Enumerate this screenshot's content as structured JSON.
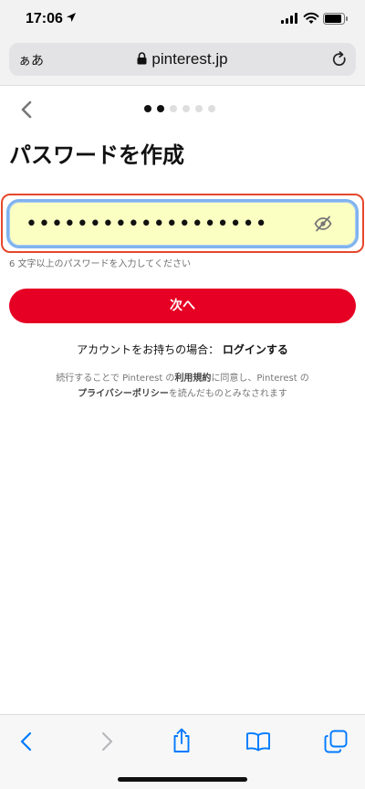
{
  "status_bar": {
    "time": "17:06"
  },
  "address_bar": {
    "aa_label": "ぁあ",
    "url": "pinterest.jp"
  },
  "progress": {
    "total_steps": 6,
    "current_step": 2
  },
  "page": {
    "title": "パスワードを作成",
    "password_masked": "•••••••••••••••••••",
    "password_hint": "6 文字以上のパスワードを入力してください",
    "next_label": "次へ",
    "login_prompt": "アカウントをお持ちの場合：",
    "login_link": "ログインする",
    "terms_part1": "続行することで Pinterest の",
    "terms_link1": "利用規約",
    "terms_part2": "に同意し、Pinterest の",
    "terms_link2": "プライバシーポリシー",
    "terms_part3": "を読んだものとみなされます"
  },
  "colors": {
    "brand_red": "#e60023",
    "autofill_yellow": "#fbffc2",
    "ios_blue": "#007aff"
  }
}
